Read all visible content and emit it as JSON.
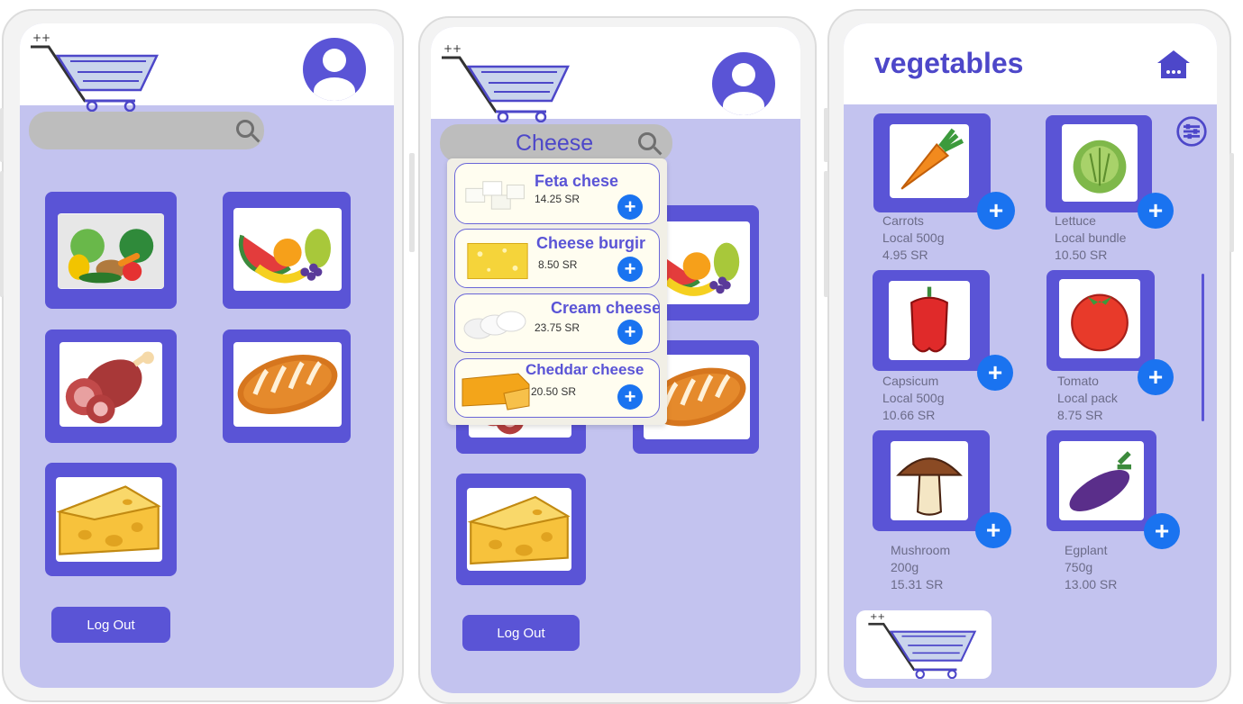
{
  "screen1": {
    "search": {
      "value": ""
    },
    "logout_label": "Log Out"
  },
  "screen2": {
    "search": {
      "value": "Cheese"
    },
    "dropdown": [
      {
        "name": "Feta chese",
        "price": "14.25 SR",
        "image": "feta-cheese"
      },
      {
        "name": "Cheese burgir",
        "price": "8.50 SR",
        "image": "cheese-slice"
      },
      {
        "name": "Cream cheese",
        "price": "23.75 SR",
        "image": "cream-cheese"
      },
      {
        "name": "Cheddar cheese",
        "price": "20.50 SR",
        "image": "cheddar-cheese"
      }
    ],
    "logout_label": "Log Out"
  },
  "screen3": {
    "title": "vegetables",
    "products": [
      {
        "name": "Carrots",
        "size": "Local 500g",
        "price": "4.95 SR",
        "image": "carrot"
      },
      {
        "name": "Lettuce",
        "size": "Local bundle",
        "price": "10.50 SR",
        "image": "lettuce"
      },
      {
        "name": "Capsicum",
        "size": "Local 500g",
        "price": "10.66 SR",
        "image": "capsicum"
      },
      {
        "name": "Tomato",
        "size": "Local pack",
        "price": "8.75 SR",
        "image": "tomato"
      },
      {
        "name": "Mushroom",
        "size": "200g",
        "price": "15.31 SR",
        "image": "mushroom"
      },
      {
        "name": "Egplant",
        "size": "750g",
        "price": "13.00 SR",
        "image": "eggplant"
      }
    ]
  },
  "categories": [
    "vegetables",
    "fruits",
    "meat",
    "bread",
    "cheese"
  ],
  "icons": {
    "add": "+",
    "search": "search-icon",
    "home": "home-icon",
    "filter": "filter-icon",
    "profile": "profile-icon",
    "cart": "cart-icon"
  },
  "colors": {
    "accent": "#5a54d6",
    "background": "#c3c3ef",
    "add_button": "#1a73f0"
  }
}
